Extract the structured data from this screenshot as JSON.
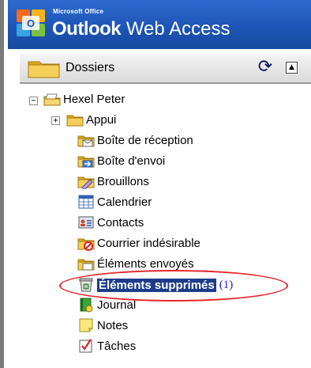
{
  "header": {
    "brand_small": "Microsoft Office",
    "product_bold": "Outlook",
    "product_rest": " Web Access"
  },
  "folder_bar": {
    "title": "Dossiers",
    "refresh_icon": "refresh-icon",
    "collapse_icon": "collapse-up-icon",
    "collapse_glyph": "▲"
  },
  "mailbox": {
    "name": "Hexel Peter",
    "expander": "⊟"
  },
  "folders": [
    {
      "label": "Appui",
      "icon": "folder-icon",
      "expander": "+"
    },
    {
      "label": "Boîte de réception",
      "icon": "inbox-icon"
    },
    {
      "label": "Boîte d'envoi",
      "icon": "outbox-icon"
    },
    {
      "label": "Brouillons",
      "icon": "drafts-icon"
    },
    {
      "label": "Calendrier",
      "icon": "calendar-icon"
    },
    {
      "label": "Contacts",
      "icon": "contacts-icon"
    },
    {
      "label": "Courrier indésirable",
      "icon": "junk-mail-icon"
    },
    {
      "label": "Éléments envoyés",
      "icon": "sent-items-icon"
    },
    {
      "label": "Éléments supprimés",
      "icon": "deleted-items-icon",
      "selected": true,
      "count": "(1)"
    },
    {
      "label": "Journal",
      "icon": "journal-icon"
    },
    {
      "label": "Notes",
      "icon": "notes-icon"
    },
    {
      "label": "Tâches",
      "icon": "tasks-icon"
    }
  ],
  "colors": {
    "header_blue": "#1d55b6",
    "selection_blue": "#1c3c8a",
    "annotation_red": "#e3262a",
    "count_blue": "#1f1fcc"
  }
}
